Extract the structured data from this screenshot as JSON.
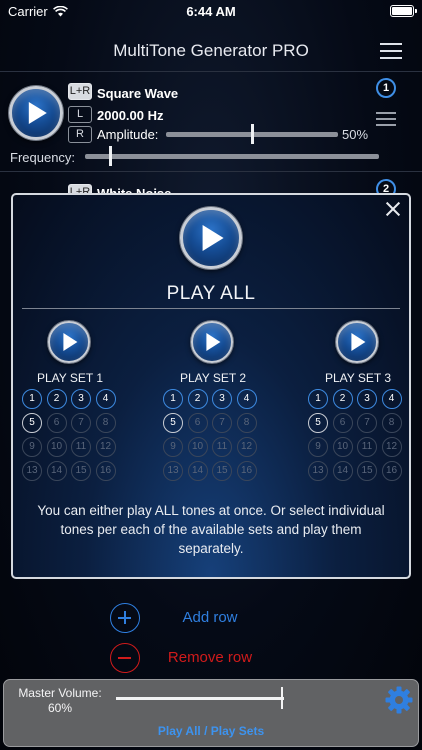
{
  "status_bar": {
    "carrier": "Carrier",
    "time": "6:44 AM"
  },
  "app": {
    "title": "MultiTone Generator PRO"
  },
  "tone_row": {
    "channel_both": "L+R",
    "channel_left": "L",
    "channel_right": "R",
    "waveform": "Square Wave",
    "frequency": "2000.00 Hz",
    "amplitude_label": "Amplitude:",
    "amplitude_value": "50%",
    "amplitude_level": 0.5,
    "frequency_label": "Frequency:",
    "frequency_level": 0.08,
    "index": "1"
  },
  "tone_row_2": {
    "channel_both": "L+R",
    "waveform": "White Noise",
    "index": "2"
  },
  "modal": {
    "title": "PLAY ALL",
    "sets": [
      {
        "label": "PLAY SET 1",
        "tones": [
          "1",
          "2",
          "3",
          "4",
          "5",
          "6",
          "7",
          "8",
          "9",
          "10",
          "11",
          "12",
          "13",
          "14",
          "15",
          "16"
        ]
      },
      {
        "label": "PLAY SET 2",
        "tones": [
          "1",
          "2",
          "3",
          "4",
          "5",
          "6",
          "7",
          "8",
          "9",
          "10",
          "11",
          "12",
          "13",
          "14",
          "15",
          "16"
        ]
      },
      {
        "label": "PLAY SET 3",
        "tones": [
          "1",
          "2",
          "3",
          "4",
          "5",
          "6",
          "7",
          "8",
          "9",
          "10",
          "11",
          "12",
          "13",
          "14",
          "15",
          "16"
        ]
      }
    ],
    "description": "You can either play ALL tones at once. Or select individual tones per each of the available sets and play them separately."
  },
  "actions": {
    "add_row": "Add row",
    "remove_row": "Remove row"
  },
  "footer": {
    "master_volume_label": "Master Volume:",
    "master_volume_value": "60%",
    "master_volume_level": 0.6,
    "play_sets_link": "Play All / Play Sets"
  },
  "colors": {
    "accent": "#2f7fe0",
    "danger": "#d01b1b",
    "footer_bg": "#616264"
  }
}
